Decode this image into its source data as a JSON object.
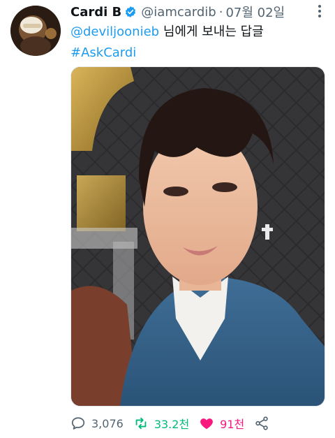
{
  "tweet": {
    "display_name": "Cardi B",
    "handle": "@iamcardib",
    "separator": "·",
    "timestamp": "07월 02일",
    "mention": "@deviljoonieb",
    "reply_text": " 님에게 보내는 답글",
    "hashtag": "#AskCardi"
  },
  "actions": {
    "replies": "3,076",
    "retweets": "33.2천",
    "likes": "91천"
  },
  "icons": {
    "verified": "verified-badge-icon",
    "more": "more-vertical-icon",
    "reply": "reply-icon",
    "retweet": "retweet-icon",
    "like": "heart-icon",
    "share": "share-icon"
  },
  "colors": {
    "accent": "#1d9bf0",
    "retweet": "#00ba7c",
    "like": "#f91880",
    "muted": "#536471"
  }
}
